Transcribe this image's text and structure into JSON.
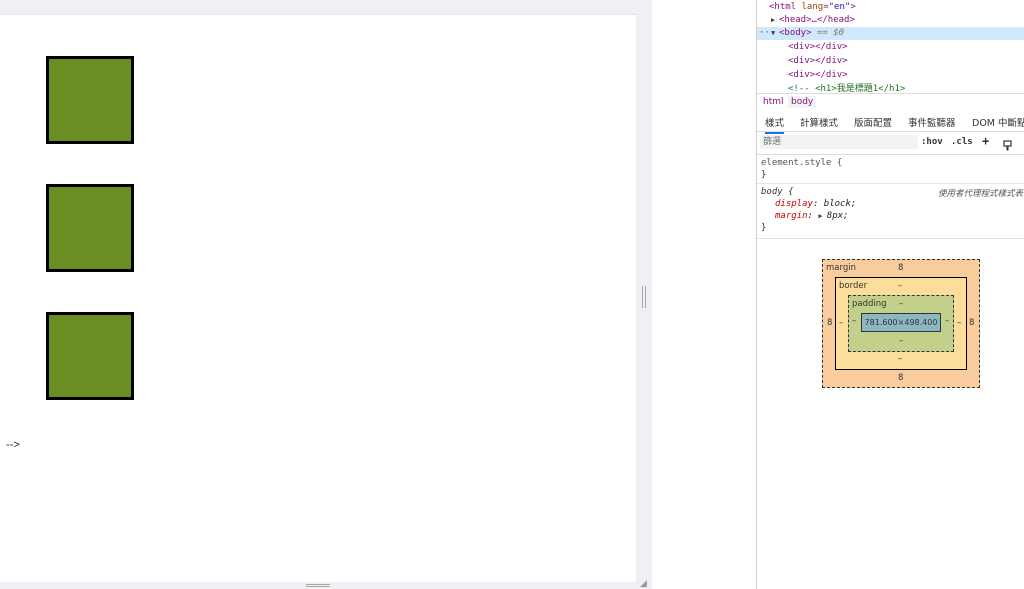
{
  "page": {
    "comment_tail": "-->"
  },
  "dom_tree": {
    "lines": [
      {
        "prefix": "",
        "open": "<html ",
        "attr": "lang",
        "val": "\"en\"",
        "close": ">"
      },
      {
        "prefix": "▶",
        "text": "<head>…</head>"
      },
      {
        "prefix": "▼",
        "text": "<body>",
        "suffix": " == $0"
      },
      {
        "text": "<div></div>"
      },
      {
        "text": "<div></div>"
      },
      {
        "text": "<div></div>"
      },
      {
        "text": "<!-- <h1>我是標題1</h1>"
      }
    ],
    "selected_dots": "···"
  },
  "breadcrumbs": [
    "html",
    "body"
  ],
  "panel_tabs": [
    "樣式",
    "計算樣式",
    "版面配置",
    "事件監聽器",
    "DOM 中斷點"
  ],
  "filter": {
    "placeholder": "篩選",
    "hov": ":hov",
    "cls": ".cls",
    "add": "+",
    "icons": [
      "plus-icon",
      "paint-icon"
    ]
  },
  "rules": {
    "element_style": {
      "selector": "element.style {",
      "close": "}"
    },
    "body": {
      "selector": "body {",
      "source": "使用者代理程式樣式表",
      "props": [
        {
          "name": "display",
          "value": "block;"
        },
        {
          "name": "margin",
          "value": "8px;"
        }
      ],
      "close": "}"
    }
  },
  "box_model": {
    "margin_label": "margin",
    "margin_top": "8",
    "margin_bottom": "8",
    "margin_left": "8",
    "margin_right": "8",
    "border_label": "border",
    "border_top": "–",
    "border_bottom": "–",
    "border_left": "–",
    "border_right": "–",
    "padding_label": "padding",
    "padding_top": "–",
    "padding_bottom": "–",
    "padding_left": "–",
    "padding_right": "–",
    "content": "781.600×498.400"
  }
}
